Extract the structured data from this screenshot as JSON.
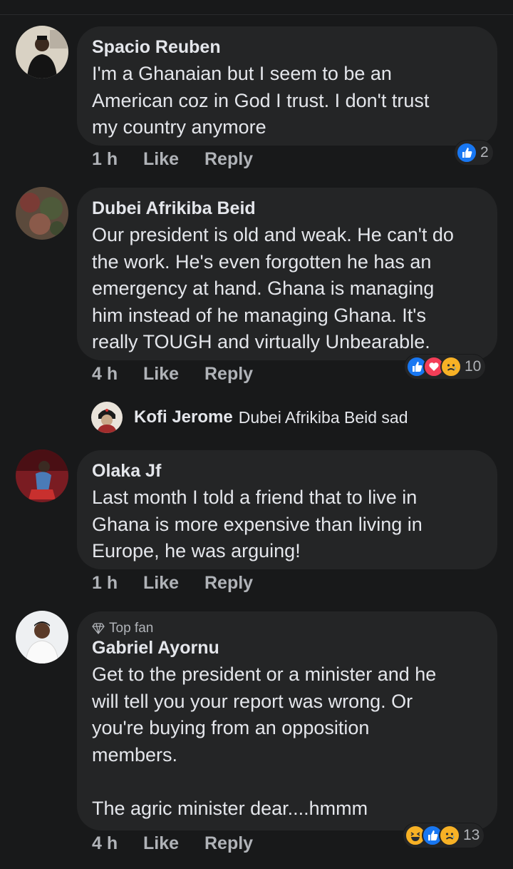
{
  "labels": {
    "like": "Like",
    "reply": "Reply"
  },
  "comments": [
    {
      "name": "Spacio Reuben",
      "text": "I'm a Ghanaian but I seem to be an\nAmerican coz in God I trust. I don't trust\nmy country anymore",
      "time": "1 h",
      "reactions": [
        "like-icon"
      ],
      "reaction_count": "2"
    },
    {
      "name": "Dubei Afrikiba Beid",
      "text": "Our president is old and weak. He can't do\nthe work. He's even forgotten he has an\nemergency at hand. Ghana is managing\nhim instead of he managing Ghana. It's\nreally TOUGH and virtually Unbearable.",
      "time": "4 h",
      "reactions": [
        "like-icon",
        "love-icon",
        "sad-icon"
      ],
      "reaction_count": "10"
    },
    {
      "name": "Olaka Jf",
      "text": "Last month I told a friend that to live in\nGhana is more expensive than living in\nEurope, he was arguing!",
      "time": "1 h",
      "reactions": [],
      "reaction_count": ""
    },
    {
      "badge": "Top fan",
      "name": "Gabriel Ayornu",
      "text": "Get to the president or a minister and he\nwill tell you your report was wrong. Or\nyou're buying from an opposition\nmembers.\n\nThe agric minister dear....hmmm",
      "time": "4 h",
      "reactions": [
        "haha-icon",
        "like-icon",
        "sad-icon"
      ],
      "reaction_count": "13"
    }
  ],
  "reply_preview": {
    "name": "Kofi Jerome",
    "text": "Dubei Afrikiba Beid sad"
  },
  "colors": {
    "background": "#18191a",
    "bubble": "#242526",
    "like_blue": "#1877f2",
    "love_red": "#f33e58",
    "emoji_yellow": "#f7b125"
  }
}
